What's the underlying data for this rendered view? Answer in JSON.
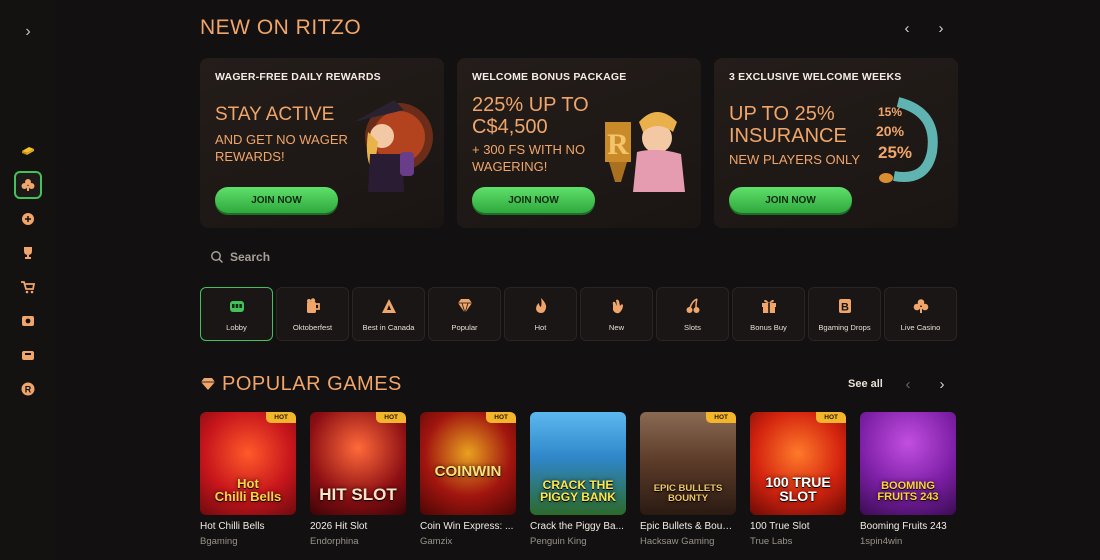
{
  "colors": {
    "accent": "#f0a56a",
    "green": "#43c15a",
    "background": "#121010",
    "hot_badge": "#f3b52b"
  },
  "sidebar": {
    "items": [
      {
        "icon": "coin-stack-icon"
      },
      {
        "icon": "club-icon",
        "active": true
      },
      {
        "icon": "sports-ball-icon"
      },
      {
        "icon": "trophy-icon"
      },
      {
        "icon": "shop-cart-icon"
      },
      {
        "icon": "lottery-ticket-icon"
      },
      {
        "icon": "gift-ticket-icon"
      },
      {
        "icon": "r-coin-icon"
      }
    ]
  },
  "new_on": {
    "title": "NEW ON RITZO",
    "promos": [
      {
        "kicker": "WAGER-FREE DAILY REWARDS",
        "headline": "STAY ACTIVE",
        "sub": "AND GET NO WAGER\nREWARDS!",
        "button": "JOIN NOW"
      },
      {
        "kicker": "WELCOME BONUS PACKAGE",
        "headline": "225% UP TO\nC$4,500",
        "sub": "+ 300 FS WITH NO\nWAGERING!",
        "button": "JOIN NOW"
      },
      {
        "kicker": "3 EXCLUSIVE WELCOME WEEKS",
        "headline": "UP TO 25%\nINSURANCE",
        "sub": "NEW PLAYERS ONLY",
        "button": "JOIN NOW",
        "art_text": [
          "15%",
          "20%",
          "25%"
        ]
      }
    ]
  },
  "search": {
    "placeholder": "Search"
  },
  "categories": [
    {
      "label": "Lobby",
      "icon": "slot-machine-icon",
      "active": true
    },
    {
      "label": "Oktoberfest",
      "icon": "beer-mug-icon"
    },
    {
      "label": "Best in Canada",
      "icon": "maple-a-icon"
    },
    {
      "label": "Popular",
      "icon": "diamond-icon"
    },
    {
      "label": "Hot",
      "icon": "flame-icon"
    },
    {
      "label": "New",
      "icon": "hand-wave-icon"
    },
    {
      "label": "Slots",
      "icon": "cherries-icon"
    },
    {
      "label": "Bonus Buy",
      "icon": "gift-box-icon"
    },
    {
      "label": "Bgaming Drops",
      "icon": "b-badge-icon"
    },
    {
      "label": "Live Casino",
      "icon": "club-icon"
    }
  ],
  "popular": {
    "title": "POPULAR GAMES",
    "see_all": "See all",
    "games": [
      {
        "name": "Hot Chilli Bells",
        "provider": "Bgaming",
        "badge": "HOT",
        "art": "Hot\nChilli Bells",
        "bg": "#c8161c"
      },
      {
        "name": "2026 Hit Slot",
        "provider": "Endorphina",
        "badge": "HOT",
        "art": "HIT SLOT",
        "bg": "#8d0f14"
      },
      {
        "name": "Coin Win Express: ...",
        "provider": "Gamzix",
        "badge": "HOT",
        "art": "COINWIN",
        "bg": "#a2150f"
      },
      {
        "name": "Crack the Piggy Ba...",
        "provider": "Penguin King",
        "badge": "",
        "art": "CRACK THE\nPIGGY BANK",
        "bg": "#2f86c8"
      },
      {
        "name": "Epic Bullets & Boun...",
        "provider": "Hacksaw Gaming",
        "badge": "HOT",
        "art": "EPIC BULLETS\nBOUNTY",
        "bg": "#5a3a28"
      },
      {
        "name": "100 True Slot",
        "provider": "True Labs",
        "badge": "HOT",
        "art": "100 TRUE\nSLOT",
        "bg": "#d4240f"
      },
      {
        "name": "Booming Fruits 243",
        "provider": "1spin4win",
        "badge": "",
        "art": "BOOMING\nFRUITS 243",
        "bg": "#7d1fa6"
      }
    ]
  }
}
